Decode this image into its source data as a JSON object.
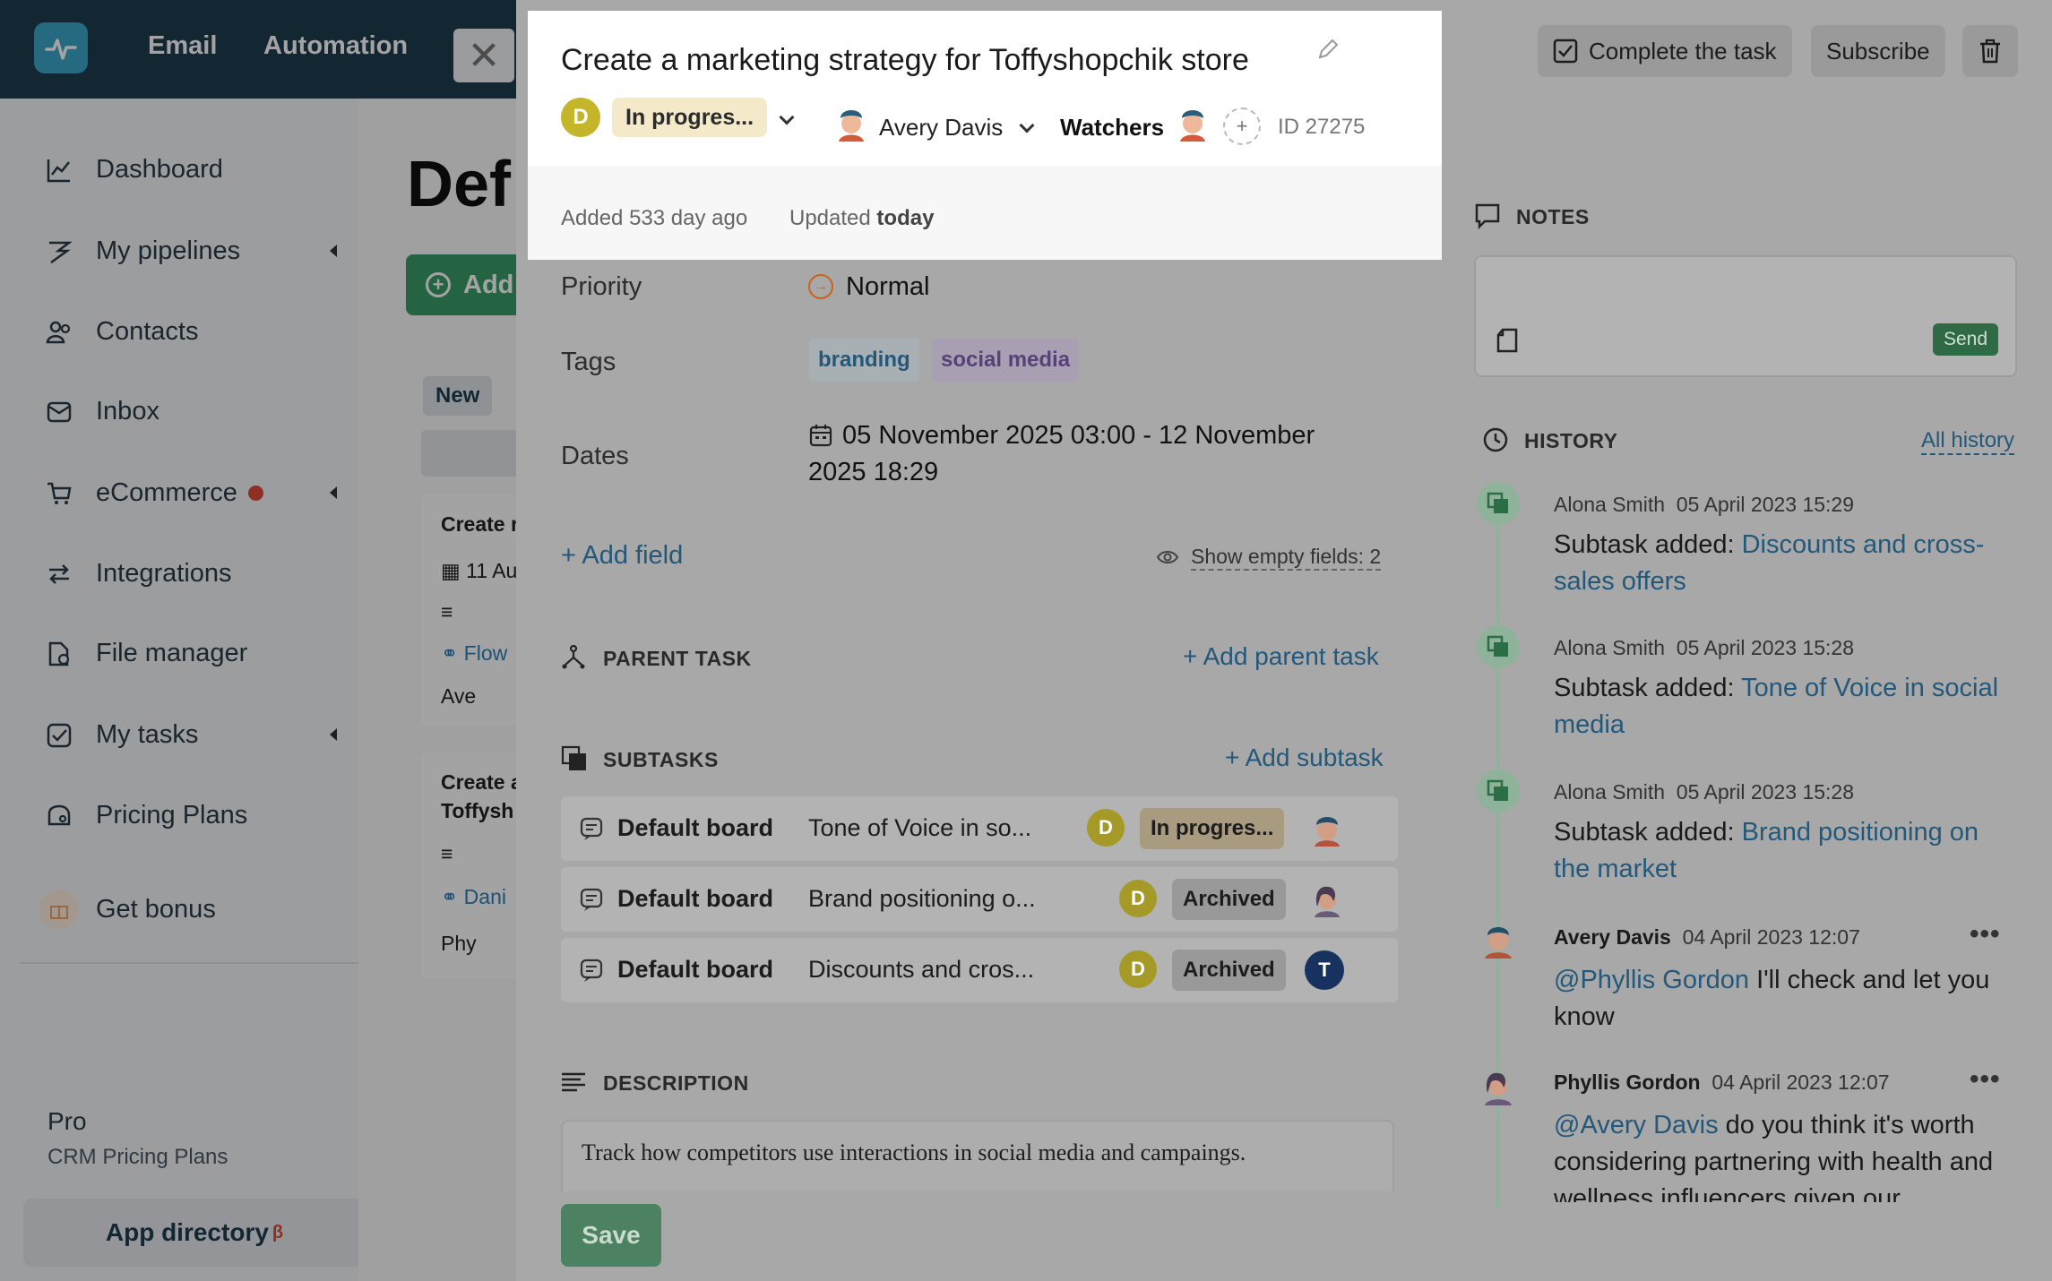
{
  "app": {
    "topnav": [
      "Email",
      "Automation"
    ],
    "sidebar": {
      "items": [
        {
          "label": "Dashboard",
          "icon": "chart-line-icon"
        },
        {
          "label": "My pipelines",
          "icon": "pipeline-icon"
        },
        {
          "label": "Contacts",
          "icon": "contacts-icon"
        },
        {
          "label": "Inbox",
          "icon": "inbox-icon"
        },
        {
          "label": "eCommerce",
          "icon": "cart-icon"
        },
        {
          "label": "Integrations",
          "icon": "integrations-icon"
        },
        {
          "label": "File manager",
          "icon": "file-icon"
        },
        {
          "label": "My tasks",
          "icon": "checkbox-icon"
        },
        {
          "label": "Pricing Plans",
          "icon": "pricing-icon"
        }
      ],
      "bonus": "Get bonus",
      "plan_name": "Pro",
      "plan_sub": "CRM Pricing Plans",
      "app_directory": "App directory",
      "beta": "β"
    },
    "board": {
      "title": "Def",
      "add": "Add",
      "column_new": "New",
      "card1": {
        "title": "Create r",
        "date": "11 Au",
        "link": "Flow",
        "user": "Ave"
      },
      "card2": {
        "title": "Create a",
        "title2": "Toffysh",
        "link": "Dani",
        "user": "Phy"
      }
    }
  },
  "task": {
    "title": "Create a marketing strategy for Toffyshopchik store",
    "status_avatar": "D",
    "status": "In progres...",
    "assignee": "Avery Davis",
    "watchers_label": "Watchers",
    "add_watcher": "+",
    "id_label": "ID 27275",
    "added": "Added 533 day ago",
    "updated_prefix": "Updated",
    "updated_value": "today",
    "priority_label": "Priority",
    "priority_value": "Normal",
    "tags_label": "Tags",
    "tags": [
      "branding",
      "social media"
    ],
    "dates_label": "Dates",
    "dates_line1": "05 November 2025 03:00 - 12 November",
    "dates_line2": "2025 18:29",
    "add_field": "+ Add field",
    "show_empty": "Show empty fields: 2",
    "parent_task_label": "PARENT TASK",
    "add_parent": "+ Add parent task",
    "subtasks_label": "SUBTASKS",
    "add_subtask": "+ Add subtask",
    "subtasks": [
      {
        "board": "Default board",
        "name": "Tone of Voice in so...",
        "avatar": "D",
        "status": "In progres..."
      },
      {
        "board": "Default board",
        "name": "Brand positioning o...",
        "avatar": "D",
        "status": "Archived"
      },
      {
        "board": "Default board",
        "name": "Discounts and cros...",
        "avatar": "D",
        "status": "Archived",
        "assignee_initial": "T"
      }
    ],
    "description_label": "DESCRIPTION",
    "description": "Track how competitors use interactions in social media and campaings.",
    "save": "Save"
  },
  "actions": {
    "complete": "Complete the task",
    "subscribe": "Subscribe"
  },
  "notes": {
    "label": "NOTES",
    "send": "Send"
  },
  "history": {
    "label": "HISTORY",
    "all": "All history",
    "entries": [
      {
        "author": "Alona Smith",
        "time": "05 April 2023 15:29",
        "prefix": "Subtask added:",
        "link": "Discounts and cross-sales offers"
      },
      {
        "author": "Alona Smith",
        "time": "05 April 2023 15:28",
        "prefix": "Subtask added:",
        "link": "Tone of Voice in social media"
      },
      {
        "author": "Alona Smith",
        "time": "05 April 2023 15:28",
        "prefix": "Subtask added:",
        "link": "Brand positioning on the market"
      },
      {
        "author": "Avery Davis",
        "time": "04 April 2023 12:07",
        "mention": "@Phyllis Gordon",
        "text": " I'll check and let you know"
      },
      {
        "author": "Phyllis Gordon",
        "time": "04 April 2023 12:07",
        "mention": "@Avery Davis",
        "text": " do you think it's worth considering partnering with health and wellness influencers given our"
      }
    ]
  },
  "colors": {
    "topbar": "#1e3d4f",
    "accent_green": "#3a9d6a",
    "link": "#24587a",
    "status_avatar": "#c4b52b"
  }
}
